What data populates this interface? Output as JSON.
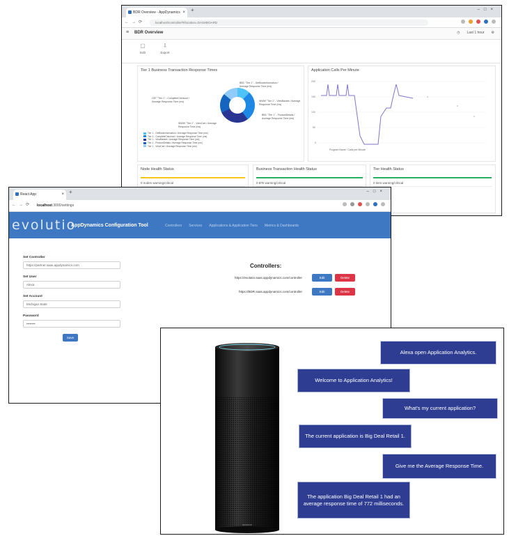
{
  "dashboard": {
    "tab_title": "BDR Overview - AppDynamics",
    "url": "localhost/controller/#/location=DASHBOARD",
    "app_title": "BDR Overview",
    "header_right": [
      "Last 1 hour"
    ],
    "tools": [
      {
        "label": "Edit",
        "icon": "edit-icon"
      },
      {
        "label": "Export",
        "icon": "download-icon"
      }
    ],
    "card1_title": "Tier 1 Business Transaction Response Times",
    "card2_title": "Application Calls Per Minute",
    "donut_callouts": [
      "BBC \"Tier 1\" - GetBookInformation / Average Response Time (ms)",
      "CBT \"Tier 1\" - CompleteCheckout / Average Response Time (ms)",
      "WWW \"Tier 1\" - ViewBasket / Average Response Time (ms)",
      "BBC \"Tier 1\" - ProductDetails / Average Response Time (ms)",
      "WWW \"Tier 1\" - ViewCart / Average Response Time (ms)"
    ],
    "legend": [
      "Tier 1 - GetBookInformation / Average Response Time (ms)",
      "Tier 1 - CompleteCheckout / Average Response Time (ms)",
      "Tier 1 - ViewBasket / Average Response Time (ms)",
      "Tier 1 - ProductDetails / Average Response Time (ms)",
      "Tier 1 - ViewCart / Average Response Time (ms)"
    ],
    "line_legend": "Program Name / Calls per Minute",
    "health_cards": [
      {
        "title": "Node Health Status",
        "status": "0 nodes warning/critical",
        "color": "#f5c518"
      },
      {
        "title": "Business Transaction Health Status",
        "status": "0 BTs warning/critical",
        "color": "#27b060"
      },
      {
        "title": "Tier Health Status",
        "status": "0 tiers warning/critical",
        "color": "#27b060"
      }
    ]
  },
  "config_tool": {
    "tab_title": "React App",
    "url_host": "localhost",
    "url_path": ":3000/settings",
    "logo": "evolutio",
    "brand": "AppDynamics Configuration Tool",
    "nav": [
      "Controllers",
      "Services",
      "Applications & Application Tiers",
      "Metrics & Dashboards"
    ],
    "form": {
      "controller_label": "Set Controller",
      "controller_value": "https://partner.saas.appdynamics.com",
      "user_label": "Set User",
      "user_value": "Alexa",
      "account_label": "Set Account",
      "account_value": "Michigan State",
      "password_label": "Password",
      "password_value": "••••••••",
      "save_label": "Save"
    },
    "controllers_title": "Controllers:",
    "controllers": [
      {
        "url": "https://evolutio.saas.appdynamics.com/controller",
        "edit": "Edit",
        "delete": "Delete"
      },
      {
        "url": "https://BDR.saas.appdynamics.com/controller",
        "edit": "Edit",
        "delete": "Delete"
      }
    ]
  },
  "conversation": [
    {
      "speaker": "user",
      "text": "Alexa open Application Analytics."
    },
    {
      "speaker": "alexa",
      "text": "Welcome to Application Analytics!"
    },
    {
      "speaker": "user",
      "text": "What's my current application?"
    },
    {
      "speaker": "alexa",
      "text": "The current application is Big Deal Retail 1."
    },
    {
      "speaker": "user",
      "text": "Give me the Average Response Time."
    },
    {
      "speaker": "alexa",
      "text": "The application Big Deal Retail 1 had an average response time of 772 milliseconds."
    }
  ],
  "device_label": "amazon",
  "colors": {
    "app_blue": "#3f78c2",
    "delete_red": "#dc3545",
    "bubble_blue": "#2e3d91"
  }
}
